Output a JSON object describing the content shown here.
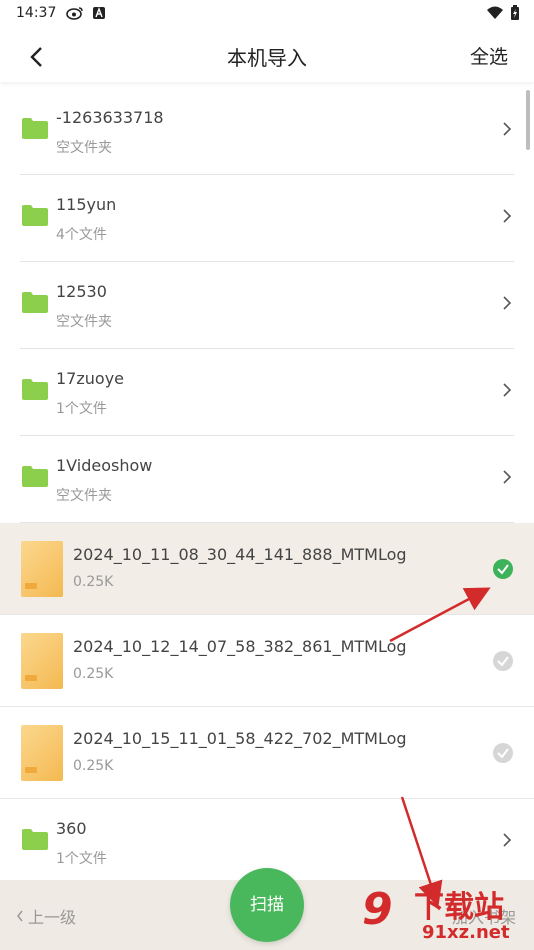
{
  "status_bar": {
    "time": "14:37"
  },
  "header": {
    "title": "本机导入",
    "select_all": "全选"
  },
  "folders_top": [
    {
      "name": "-1263633718",
      "sub": "空文件夹"
    },
    {
      "name": "115yun",
      "sub": "4个文件"
    },
    {
      "name": "12530",
      "sub": "空文件夹"
    },
    {
      "name": "17zuoye",
      "sub": "1个文件"
    },
    {
      "name": "1Videoshow",
      "sub": "空文件夹"
    }
  ],
  "files": [
    {
      "name": "2024_10_11_08_30_44_141_888_MTMLog",
      "size": "0.25K",
      "selected": true
    },
    {
      "name": "2024_10_12_14_07_58_382_861_MTMLog",
      "size": "0.25K",
      "selected": false
    },
    {
      "name": "2024_10_15_11_01_58_422_702_MTMLog",
      "size": "0.25K",
      "selected": false
    }
  ],
  "folders_bottom": [
    {
      "name": "360",
      "sub": "1个文件"
    }
  ],
  "bottom_bar": {
    "up_level": "上一级",
    "scan": "扫描",
    "add_to_shelf": "加入书架"
  },
  "watermark": {
    "logo": "9",
    "main": "下载站",
    "sub": "91xz.net"
  },
  "colors": {
    "accent_green": "#49b85c",
    "selected_row": "#f2ede6",
    "arrow_red": "#d32b2b"
  }
}
